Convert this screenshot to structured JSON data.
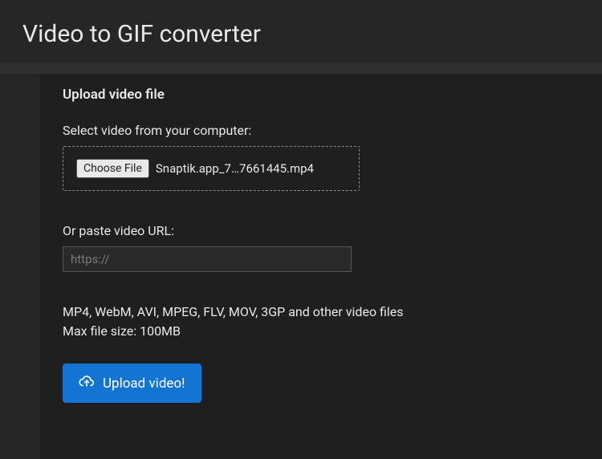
{
  "page_title": "Video to GIF converter",
  "panel": {
    "title": "Upload video file",
    "select_label": "Select video from your computer:",
    "choose_button": "Choose File",
    "file_name": "Snaptik.app_7…7661445.mp4",
    "url_label": "Or paste video URL:",
    "url_placeholder": "https://",
    "url_value": "",
    "formats_line": "MP4, WebM, AVI, MPEG, FLV, MOV, 3GP and other video files",
    "max_size_line": "Max file size: 100MB",
    "upload_button": "Upload video!"
  }
}
